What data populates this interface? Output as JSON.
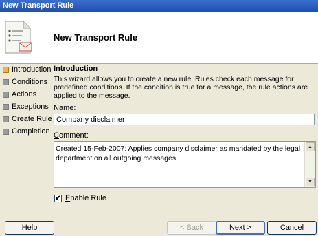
{
  "window": {
    "title": "New Transport Rule"
  },
  "header": {
    "title": "New Transport Rule",
    "icon": "wizard-document-icon"
  },
  "steps": [
    {
      "label": "Introduction",
      "active": true
    },
    {
      "label": "Conditions",
      "active": false
    },
    {
      "label": "Actions",
      "active": false
    },
    {
      "label": "Exceptions",
      "active": false
    },
    {
      "label": "Create Rule",
      "active": false
    },
    {
      "label": "Completion",
      "active": false
    }
  ],
  "intro": {
    "title": "Introduction",
    "description": "This wizard allows you to create a new rule. Rules check each message for predefined conditions. If the condition is true for a message, the rule actions are applied to the message."
  },
  "name_field": {
    "label_accel": "N",
    "label_rest": "ame:",
    "value": "Company disclaimer"
  },
  "comment_field": {
    "label_accel": "C",
    "label_rest": "omment:",
    "value": "Created 15-Feb-2007: Applies company disclaimer as mandated by the legal department on all outgoing messages."
  },
  "enable_rule": {
    "label_accel": "E",
    "label_rest": "nable Rule",
    "checked": true,
    "checkmark": "✔"
  },
  "buttons": {
    "help": "Help",
    "back": "< Back",
    "next": "Next >",
    "cancel": "Cancel"
  }
}
